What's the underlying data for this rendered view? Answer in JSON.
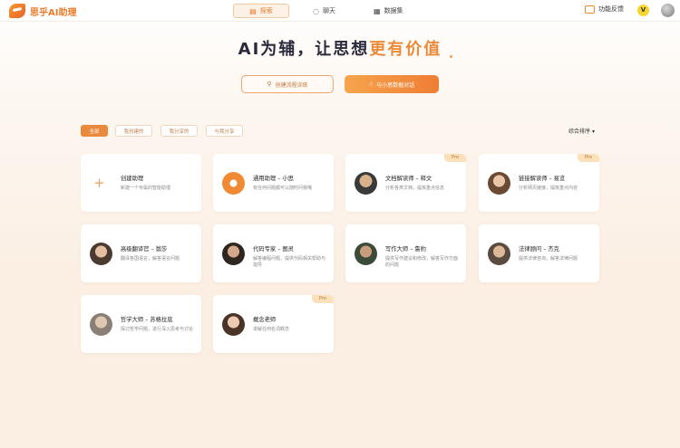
{
  "header": {
    "logo_text": "思乎AI助理",
    "tabs": [
      {
        "label": "探索",
        "icon": "explore-icon"
      },
      {
        "label": "聊天",
        "icon": "chat-icon"
      },
      {
        "label": "数据集",
        "icon": "database-icon"
      }
    ],
    "feedback_label": "功能反馈",
    "vip_badge": "V"
  },
  "hero": {
    "title_prefix": "AI为辅，让思想",
    "title_highlight": "更有价值"
  },
  "actions": {
    "create_flow": "创建流程训练",
    "chat_bot": "与小思数据对话"
  },
  "filters": [
    "全部",
    "我创建的",
    "我分享的",
    "与我分享"
  ],
  "sort_label": "综合排序",
  "accent_color": "#e9893b",
  "cards": [
    {
      "name": "创建助理",
      "desc": "新建一个专属的智能助理",
      "pro": ""
    },
    {
      "name": "通用助理 – 小思",
      "desc": "有任何问题都可以随时问我哦",
      "pro": ""
    },
    {
      "name": "文档解读师 – 释文",
      "desc": "分析各类文档，提炼重点信息",
      "pro": "Pro"
    },
    {
      "name": "链接解读师 – 易览",
      "desc": "分析网页链接，提炼重点内容",
      "pro": "Pro"
    },
    {
      "name": "高级翻译官 – 翁莎",
      "desc": "翻译各国语言，解答语言问题",
      "pro": ""
    },
    {
      "name": "代码专家 – 图灵",
      "desc": "解答编程问题，提供代码相关帮助与指导",
      "pro": ""
    },
    {
      "name": "写作大师 – 鲁豹",
      "desc": "提供写作建议和修改，解答写作方面的问题",
      "pro": ""
    },
    {
      "name": "法律顾问 – 杰克",
      "desc": "提供法律咨询，解答法律问题",
      "pro": ""
    },
    {
      "name": "哲学大师 – 苏格拉底",
      "desc": "探讨哲学问题，进行深入思考与讨论",
      "pro": ""
    },
    {
      "name": "概念老师",
      "desc": "讲解任何名词概念",
      "pro": "Pro"
    }
  ]
}
